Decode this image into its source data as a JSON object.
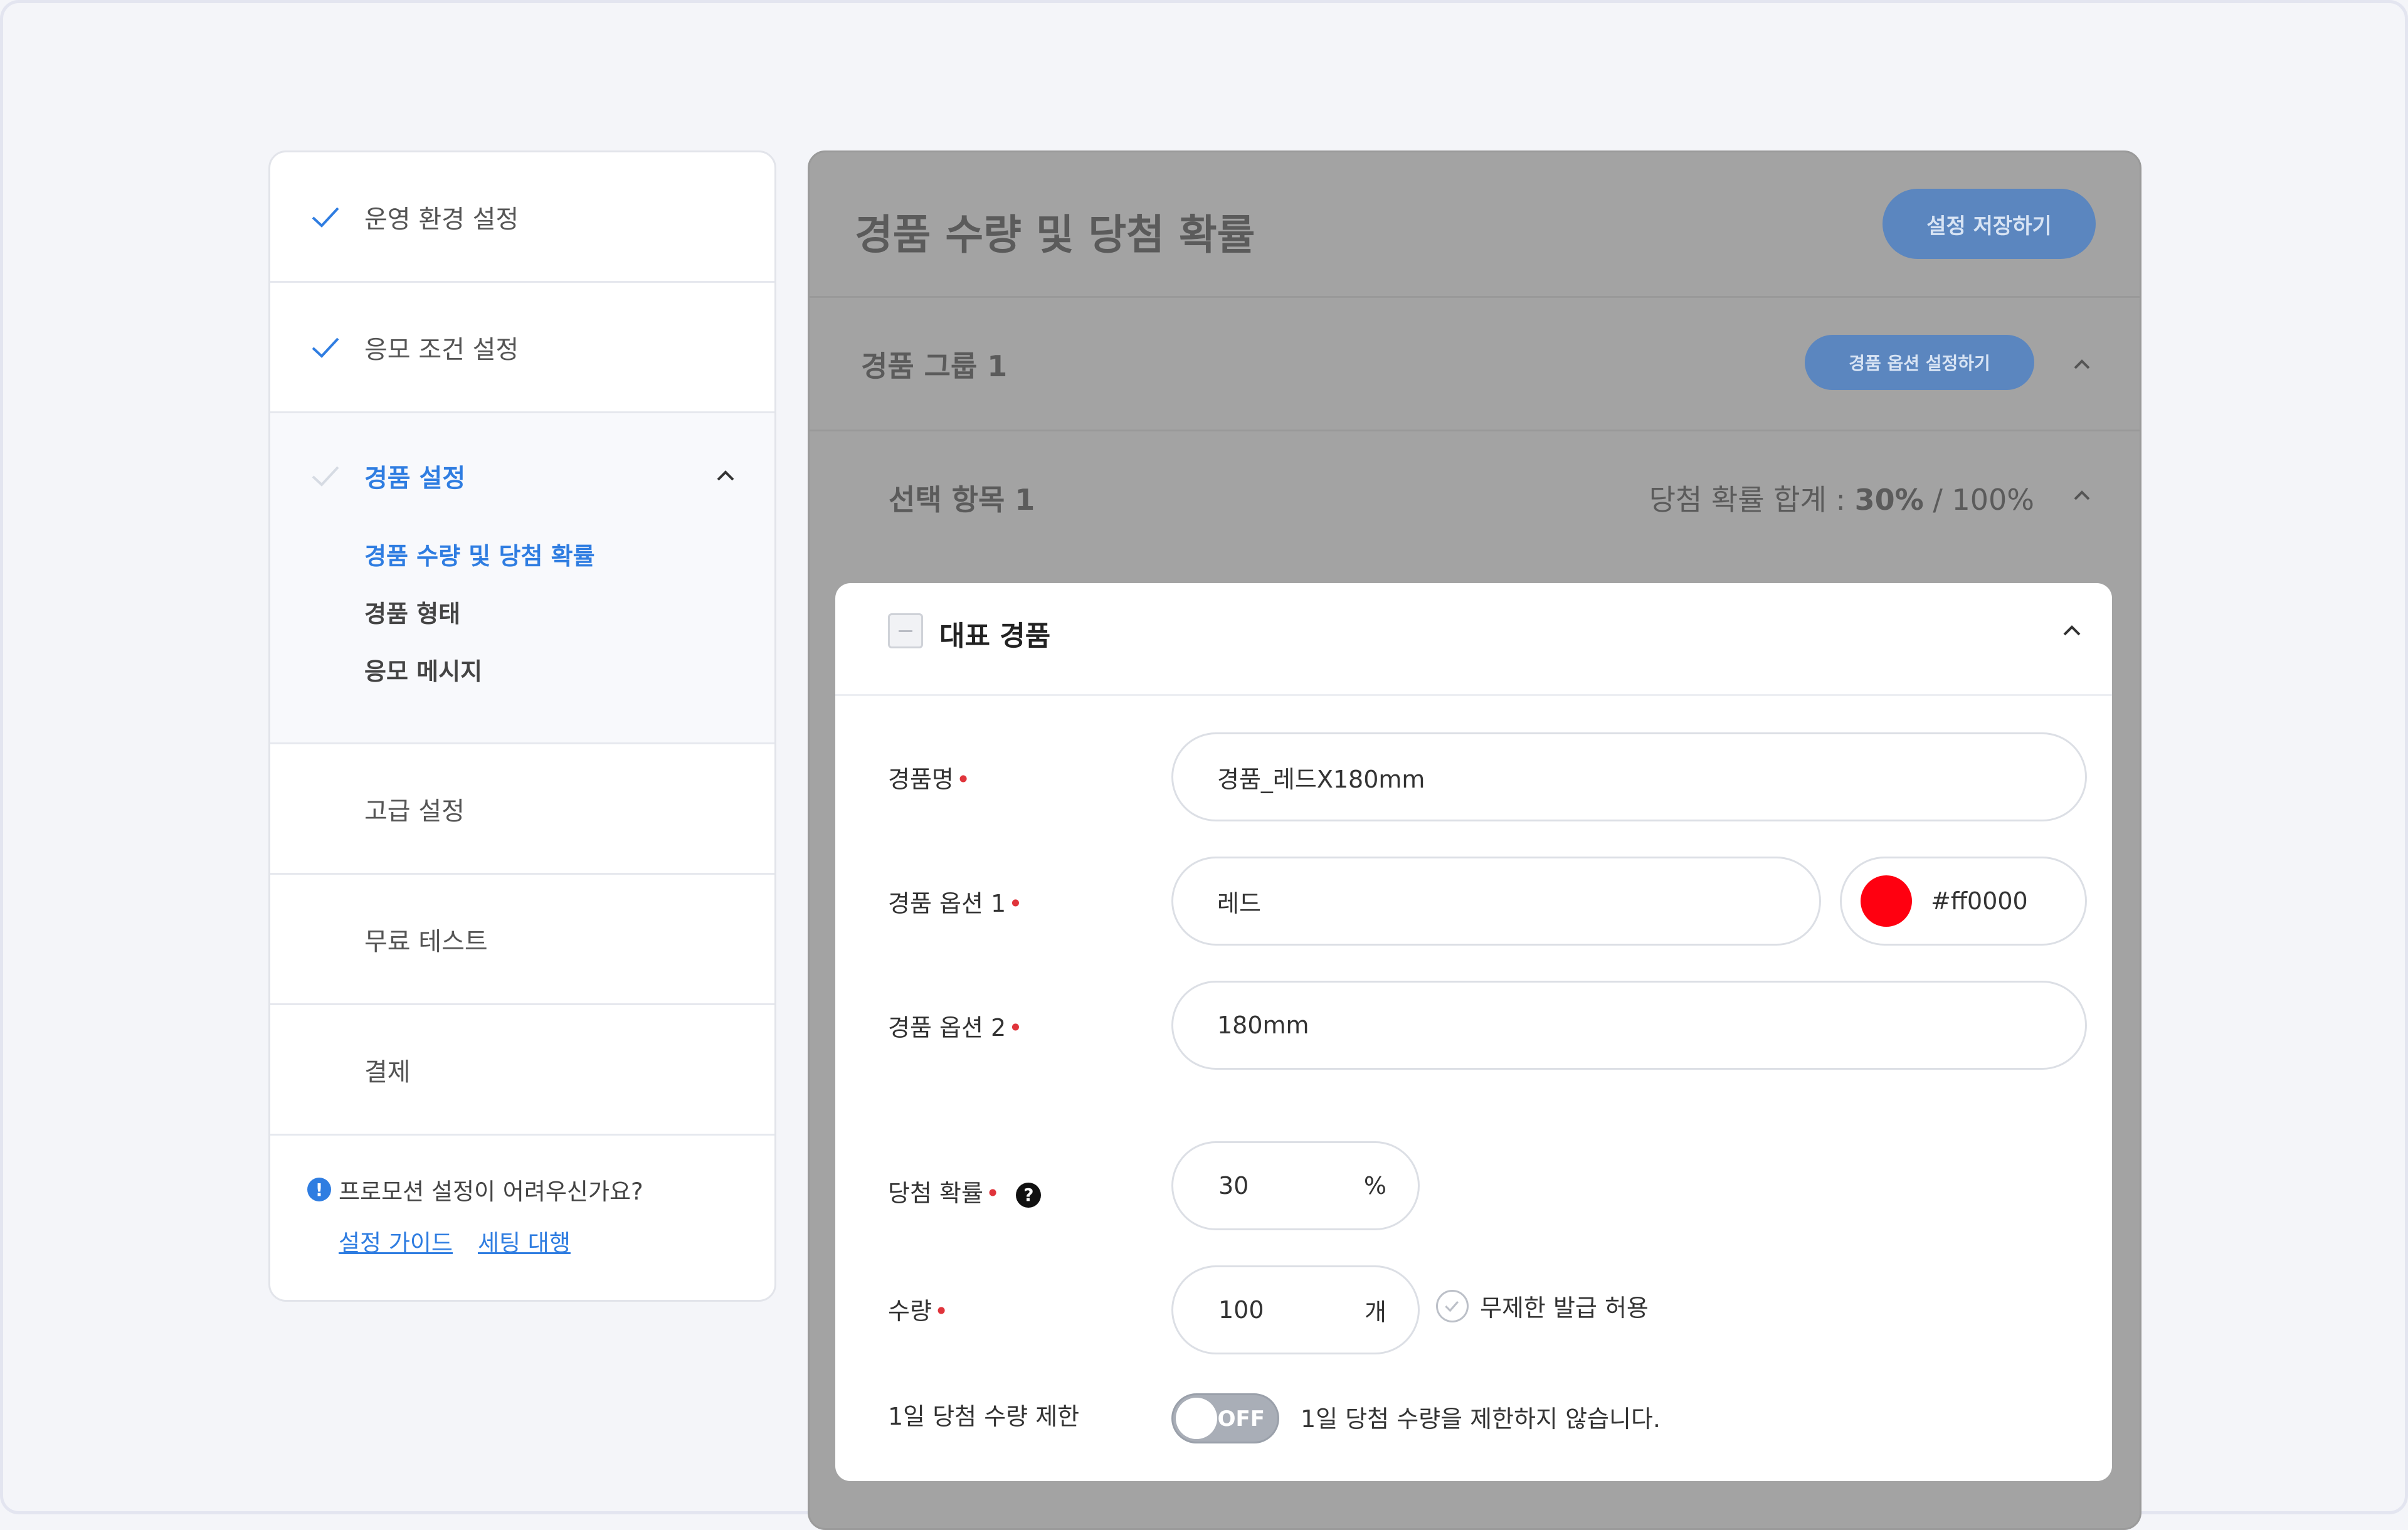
{
  "sidebar": {
    "items": [
      {
        "label": "운영 환경 설정",
        "checked": true
      },
      {
        "label": "응모 조건 설정",
        "checked": true
      },
      {
        "label": "경품 설정",
        "checked": false,
        "expanded": true,
        "subitems": [
          "경품 수량 및 당첨 확률",
          "경품 형태",
          "응모 메시지"
        ]
      },
      {
        "label": "고급 설정",
        "checked": false
      },
      {
        "label": "무료 테스트",
        "checked": false
      },
      {
        "label": "결제",
        "checked": false
      }
    ],
    "help": {
      "question": "프로모션 설정이 어려우신가요?",
      "link_guide": "설정 가이드",
      "link_setting": "세팅 대행"
    }
  },
  "main": {
    "title": "경품 수량 및 당첨 확률",
    "save_label": "설정 저장하기",
    "group": {
      "title": "경품 그룹 1",
      "option_button": "경품 옵션 설정하기"
    },
    "item": {
      "title": "선택 항목 1",
      "sum_prefix": "당첨 확률 합계 : ",
      "sum_value": "30%",
      "sum_suffix": " / 100%"
    }
  },
  "card": {
    "title": "대표 경품",
    "fields": {
      "name": {
        "label": "경품명",
        "value": "경품_레드X180mm"
      },
      "option1": {
        "label": "경품 옵션 1",
        "value": "레드",
        "color_label": "#ff0000"
      },
      "option2": {
        "label": "경품 옵션 2",
        "value": "180mm"
      },
      "probability": {
        "label": "당첨 확률",
        "value": "30",
        "unit": "%"
      },
      "quantity": {
        "label": "수량",
        "value": "100",
        "unit": "개",
        "unlimited_label": "무제한 발급 허용"
      },
      "daily_limit": {
        "label": "1일 당첨 수량 제한",
        "toggle": "OFF",
        "description": "1일 당첨 수량을 제한하지 않습니다."
      }
    }
  },
  "colors": {
    "accent": "#2f7de1",
    "swatch": "#ff0010",
    "required": "#e0343b"
  },
  "icons": {
    "check": "check-icon",
    "chevron": "chevron-up-icon",
    "info": "info-icon",
    "help": "question-icon"
  }
}
